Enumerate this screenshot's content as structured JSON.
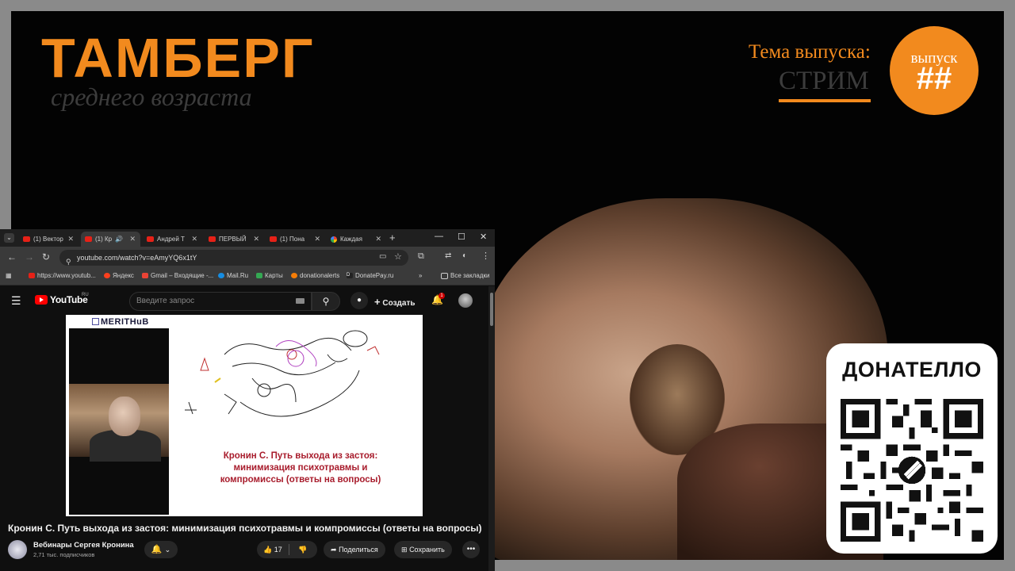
{
  "overlay": {
    "logo": "ТАМБЕРГ",
    "logo_sub": "среднего возраста",
    "theme_label": "Тема выпуска:",
    "theme_value": "СТРИМ",
    "badge_label": "выпуск",
    "badge_number": "##",
    "donate_title": "ДОНАТЕЛЛО",
    "accent_color": "#f28a1e"
  },
  "browser": {
    "tabs": [
      {
        "label": "(1) Вектор",
        "icon": "youtube-icon"
      },
      {
        "label": "(1) Кр",
        "icon": "youtube-icon",
        "active": true
      },
      {
        "label": "Андрей Т",
        "icon": "youtube-icon"
      },
      {
        "label": "ПЕРВЫЙ",
        "icon": "youtube-icon"
      },
      {
        "label": "(1) Пона",
        "icon": "youtube-icon"
      },
      {
        "label": "Каждая",
        "icon": "google-icon"
      }
    ],
    "url": "youtube.com/watch?v=eAmyYQ6x1tY",
    "bookmarks": [
      "https://www.youtub...",
      "Яндекс",
      "Gmail – Входящие -...",
      "Mail.Ru",
      "Карты",
      "donationalerts",
      "DonatePay.ru",
      "Все закладки"
    ]
  },
  "youtube": {
    "logo": "YouTube",
    "region": "RU",
    "search_placeholder": "Введите запрос",
    "create_label": "Создать",
    "notification_count": "1",
    "video": {
      "brand": "MERITHuB",
      "slide_caption": "Кронин С. Путь выхода из застоя: минимизация психотравмы и компромиссы (ответы на вопросы)",
      "title": "Кронин С. Путь выхода из застоя: минимизация психотравмы и компромиссы (ответы на вопросы)"
    },
    "channel": {
      "name": "Вебинары Сергея Кронина",
      "subscribers": "2,71 тыс. подписчиков"
    },
    "actions": {
      "likes": "17",
      "share": "Поделиться",
      "save": "Сохранить"
    }
  }
}
